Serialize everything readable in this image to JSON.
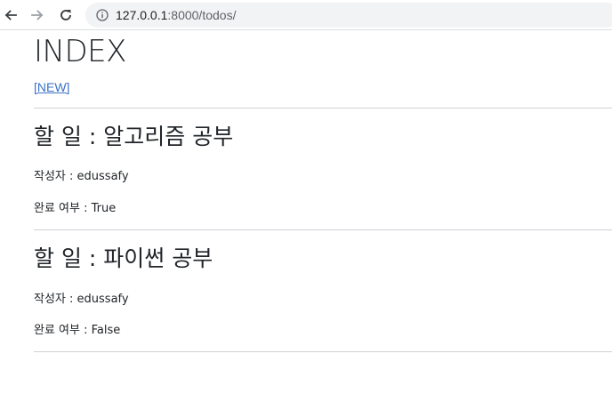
{
  "browser": {
    "url_host": "127.0.0.1",
    "url_path": ":8000/todos/",
    "icons": {
      "back": "arrow-left-icon",
      "forward": "arrow-right-icon",
      "reload": "reload-icon",
      "info": "info-icon"
    }
  },
  "page": {
    "title": "INDEX",
    "new_link": "[NEW]"
  },
  "todos": [
    {
      "title": "할 일 : 알고리즘 공부",
      "author_label": "작성자",
      "author": "edussafy",
      "completed_label": "완료 여부",
      "completed": "True"
    },
    {
      "title": "할 일 : 파이썬 공부",
      "author_label": "작성자",
      "author": "edussafy",
      "completed_label": "완료 여부",
      "completed": "False"
    }
  ],
  "colors": {
    "link": "#3b73c7",
    "text": "#212529",
    "divider": "#cfd2d6",
    "omnibox": "#f1f3f4"
  }
}
